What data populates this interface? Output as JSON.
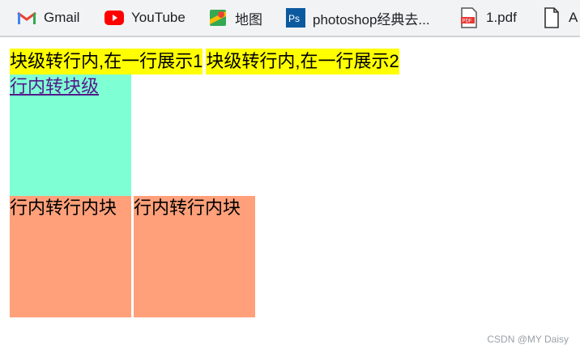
{
  "bookmarks": [
    {
      "label": "Gmail",
      "icon": "gmail-icon"
    },
    {
      "label": "YouTube",
      "icon": "youtube-icon"
    },
    {
      "label": "地图",
      "icon": "maps-icon"
    },
    {
      "label": "photoshop经典去...",
      "icon": "photoshop-icon"
    },
    {
      "label": "1.pdf",
      "icon": "pdf-icon"
    },
    {
      "label": "A",
      "icon": "file-icon"
    }
  ],
  "page": {
    "inline_blocks": [
      "块级转行内,在一行展示1",
      "块级转行内,在一行展示2"
    ],
    "block_link": "行内转块级",
    "inline_block_items": [
      "行内转行内块",
      "行内转行内块"
    ]
  },
  "watermark": "CSDN @MY Daisy",
  "colors": {
    "yellow": "#ffff00",
    "aquamarine": "#7fffd4",
    "salmon": "#ffa07a"
  }
}
